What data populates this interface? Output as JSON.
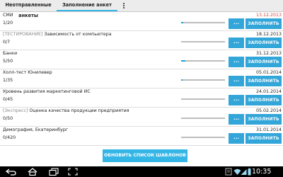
{
  "tabs": [
    {
      "label": "Неотправленные анкеты"
    },
    {
      "label": "Заполнение анкет"
    }
  ],
  "accent_color": "#33b5e5",
  "rows": [
    {
      "prefix": "",
      "title": "СМИ",
      "count": "1/20",
      "date": "13.12.2013",
      "overdue": true,
      "progress": 0.05
    },
    {
      "prefix": "[ТЕСТИРОВАНИЕ]",
      "title": " Зависимость от компьютера",
      "count": "0/7",
      "date": "18.12.2013",
      "overdue": false,
      "progress": 0
    },
    {
      "prefix": "",
      "title": "Банки",
      "count": "5/50",
      "date": "31.12.2013",
      "overdue": false,
      "progress": 0.1
    },
    {
      "prefix": "",
      "title": "Холл-тест Юнилевер",
      "count": "1/35",
      "date": "05.01.2014",
      "overdue": false,
      "progress": 0.03
    },
    {
      "prefix": "",
      "title": "Уровень развития маркетинговой ИС",
      "count": "0/45",
      "date": "24.01.2014",
      "overdue": false,
      "progress": 0
    },
    {
      "prefix": "[Экспресс]",
      "title": " Оценка качества продукции предприятия",
      "count": "0/50",
      "date": "05.02.2014",
      "overdue": false,
      "progress": 0
    },
    {
      "prefix": "",
      "title": "Демография, Екатеринбург",
      "count": "0/420",
      "date": "31.01.2014",
      "overdue": false,
      "progress": 0
    }
  ],
  "row_buttons": {
    "more_label": "...",
    "fill_label": "ЗАПОЛНИТЬ"
  },
  "refresh_label": "ОБНОВИТЬ СПИСОК ШАБЛОНОВ",
  "status_bar": {
    "time": "10:35",
    "icons": [
      "back-icon",
      "home-icon",
      "recent-apps-icon",
      "screenshot-icon",
      "notification-icon",
      "wifi-icon",
      "signal-icon",
      "battery-icon"
    ]
  }
}
